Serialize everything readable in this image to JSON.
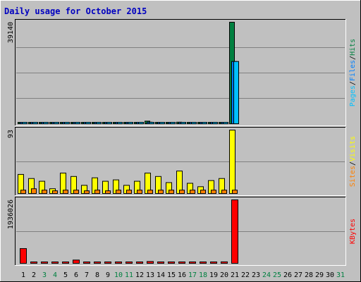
{
  "chart_data": {
    "type": "bar",
    "title": "Daily usage for October 2015",
    "categories": [
      "1",
      "2",
      "3",
      "4",
      "5",
      "6",
      "7",
      "8",
      "9",
      "10",
      "11",
      "12",
      "13",
      "14",
      "15",
      "16",
      "17",
      "18",
      "19",
      "20",
      "21",
      "22",
      "23",
      "24",
      "25",
      "26",
      "27",
      "28",
      "29",
      "30",
      "31"
    ],
    "weekend_days": [
      "3",
      "4",
      "10",
      "11",
      "17",
      "18",
      "24",
      "25",
      "31"
    ],
    "panels": [
      {
        "id": "hits",
        "ymax_label": "39140",
        "ylim": [
          0,
          39140
        ],
        "legend": [
          "Hits",
          "Files",
          "Pages"
        ],
        "series": [
          {
            "name": "Hits",
            "color": "#008040",
            "values": [
              400,
              300,
              250,
              200,
              350,
              300,
              250,
              300,
              350,
              250,
              200,
              250,
              1000,
              400,
              400,
              600,
              250,
              250,
              250,
              450,
              39140,
              0,
              0,
              0,
              0,
              0,
              0,
              0,
              0,
              0,
              0
            ]
          },
          {
            "name": "Files",
            "color": "#0080ff",
            "values": [
              250,
              200,
              150,
              120,
              200,
              180,
              150,
              180,
              200,
              150,
              120,
              150,
              600,
              250,
              250,
              400,
              150,
              150,
              150,
              300,
              24000,
              0,
              0,
              0,
              0,
              0,
              0,
              0,
              0,
              0,
              0
            ]
          },
          {
            "name": "Pages",
            "color": "#00c0ff",
            "values": [
              150,
              120,
              80,
              60,
              100,
              90,
              80,
              100,
              110,
              80,
              60,
              80,
              300,
              120,
              120,
              200,
              80,
              80,
              80,
              150,
              24000,
              0,
              0,
              0,
              0,
              0,
              0,
              0,
              0,
              0,
              0
            ]
          }
        ]
      },
      {
        "id": "visits",
        "ymax_label": "93",
        "ylim": [
          0,
          93
        ],
        "legend": [
          "Visits",
          "Sites"
        ],
        "series": [
          {
            "name": "Visits",
            "color": "#ffff00",
            "values": [
              28,
              22,
              18,
              7,
              30,
              25,
              12,
              23,
              18,
              20,
              12,
              18,
              30,
              25,
              16,
              33,
              15,
              10,
              19,
              22,
              93,
              0,
              0,
              0,
              0,
              0,
              0,
              0,
              0,
              0,
              0
            ]
          },
          {
            "name": "Sites",
            "color": "#ff8000",
            "values": [
              5,
              7,
              5,
              4,
              5,
              5,
              4,
              5,
              4,
              5,
              5,
              5,
              5,
              5,
              5,
              5,
              5,
              5,
              5,
              5,
              5,
              0,
              0,
              0,
              0,
              0,
              0,
              0,
              0,
              0,
              0
            ]
          }
        ]
      },
      {
        "id": "kbytes",
        "ymax_label": "1936026",
        "ylim": [
          0,
          1936026
        ],
        "legend": [
          "KBytes"
        ],
        "series": [
          {
            "name": "KBytes",
            "color": "#ff0000",
            "values": [
              450000,
              35000,
              20000,
              20000,
              35000,
              100000,
              20000,
              20000,
              35000,
              20000,
              20000,
              20000,
              55000,
              35000,
              35000,
              35000,
              25000,
              20000,
              20000,
              45000,
              1936026,
              0,
              0,
              0,
              0,
              0,
              0,
              0,
              0,
              0,
              0
            ]
          }
        ]
      }
    ],
    "grid": true
  },
  "colors": {
    "background": "#c0c0c0",
    "plot_bg": "#c0c0c0",
    "title": "#0000c0",
    "weekday_label": "#000000",
    "weekend_label": "#008040",
    "grid": "#808080"
  }
}
